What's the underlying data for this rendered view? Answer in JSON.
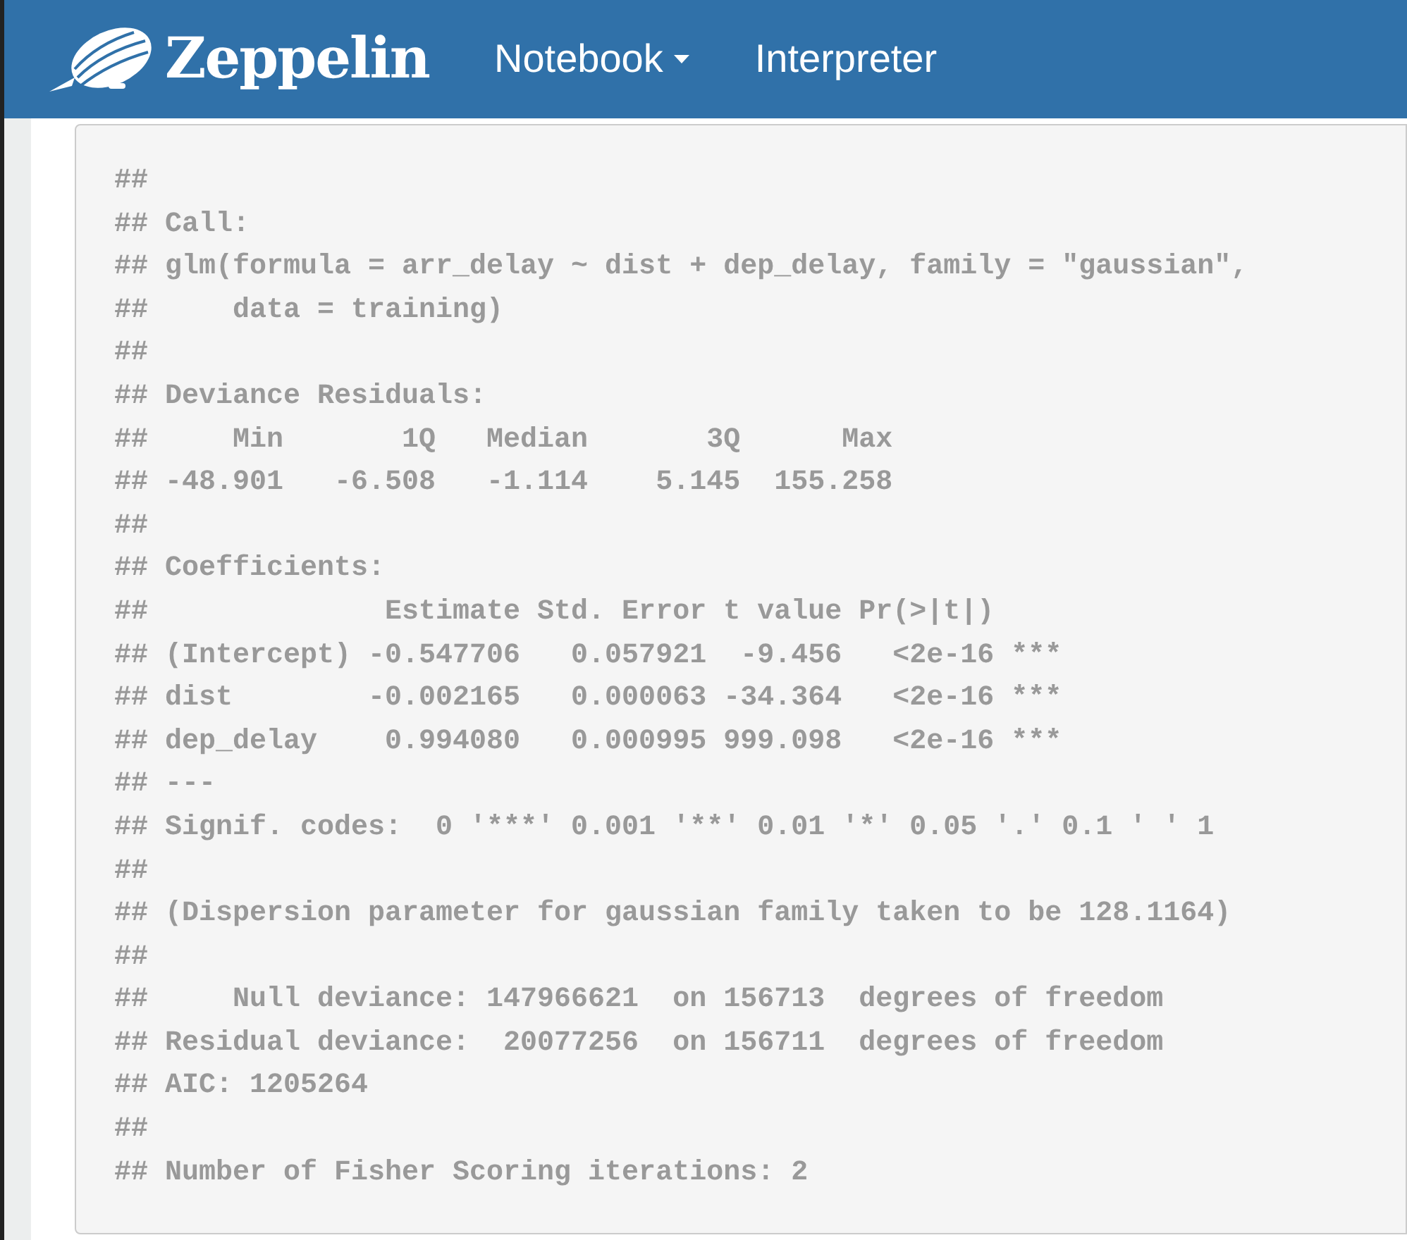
{
  "navbar": {
    "brand": "Zeppelin",
    "menu": [
      {
        "label": "Notebook",
        "kind": "dropdown"
      },
      {
        "label": "Interpreter",
        "kind": "link"
      }
    ]
  },
  "output": {
    "lines": [
      "##",
      "## Call:",
      "## glm(formula = arr_delay ~ dist + dep_delay, family = \"gaussian\",",
      "##     data = training)",
      "##",
      "## Deviance Residuals:",
      "##     Min       1Q   Median       3Q      Max",
      "## -48.901   -6.508   -1.114    5.145  155.258",
      "##",
      "## Coefficients:",
      "##              Estimate Std. Error t value Pr(>|t|)",
      "## (Intercept) -0.547706   0.057921  -9.456   <2e-16 ***",
      "## dist        -0.002165   0.000063 -34.364   <2e-16 ***",
      "## dep_delay    0.994080   0.000995 999.098   <2e-16 ***",
      "## ---",
      "## Signif. codes:  0 '***' 0.001 '**' 0.01 '*' 0.05 '.' 0.1 ' ' 1",
      "##",
      "## (Dispersion parameter for gaussian family taken to be 128.1164)",
      "##",
      "##     Null deviance: 147966621  on 156713  degrees of freedom",
      "## Residual deviance:  20077256  on 156711  degrees of freedom",
      "## AIC: 1205264",
      "##",
      "## Number of Fisher Scoring iterations: 2"
    ]
  }
}
